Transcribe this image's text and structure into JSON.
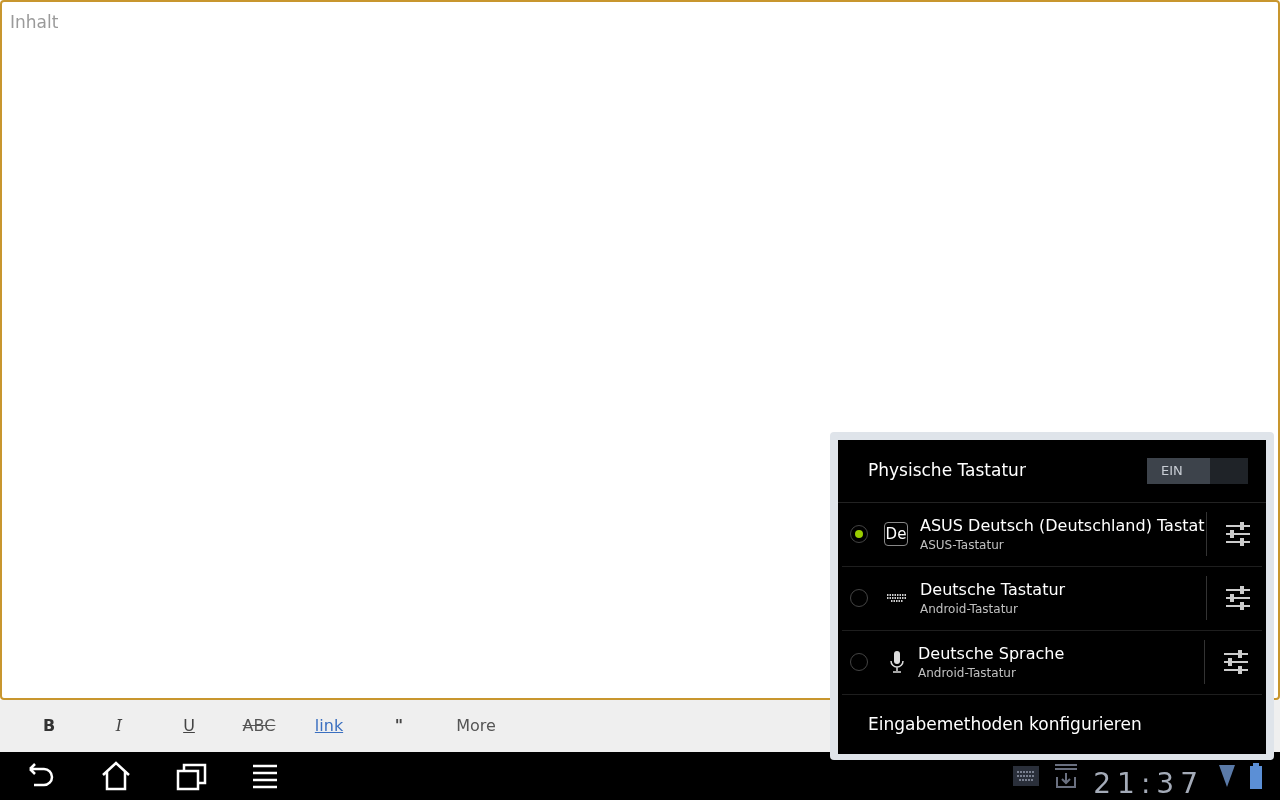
{
  "editor": {
    "placeholder": "Inhalt"
  },
  "format_toolbar": [
    {
      "kind": "bold",
      "label": "B"
    },
    {
      "kind": "italic",
      "label": "I"
    },
    {
      "kind": "underline",
      "label": "U"
    },
    {
      "kind": "strike",
      "label": "ABC"
    },
    {
      "kind": "link",
      "label": "link"
    },
    {
      "kind": "quote",
      "label": "\""
    },
    {
      "kind": "more",
      "label": "More"
    }
  ],
  "input_method_popup": {
    "physical_keyboard": {
      "label": "Physische Tastatur",
      "toggle_label": "EIN",
      "on": true
    },
    "methods": [
      {
        "name": "ASUS Deutsch (Deutschland) Tastat",
        "subtitle": "ASUS-Tastatur",
        "selected": true,
        "kind": "badge",
        "badge": "De"
      },
      {
        "name": "Deutsche Tastatur",
        "subtitle": "Android-Tastatur",
        "selected": false,
        "kind": "keyboard"
      },
      {
        "name": "Deutsche Sprache",
        "subtitle": "Android-Tastatur",
        "selected": false,
        "kind": "mic"
      }
    ],
    "configure": "Eingabemethoden konfigurieren"
  },
  "status_bar": {
    "time": "21:37"
  }
}
